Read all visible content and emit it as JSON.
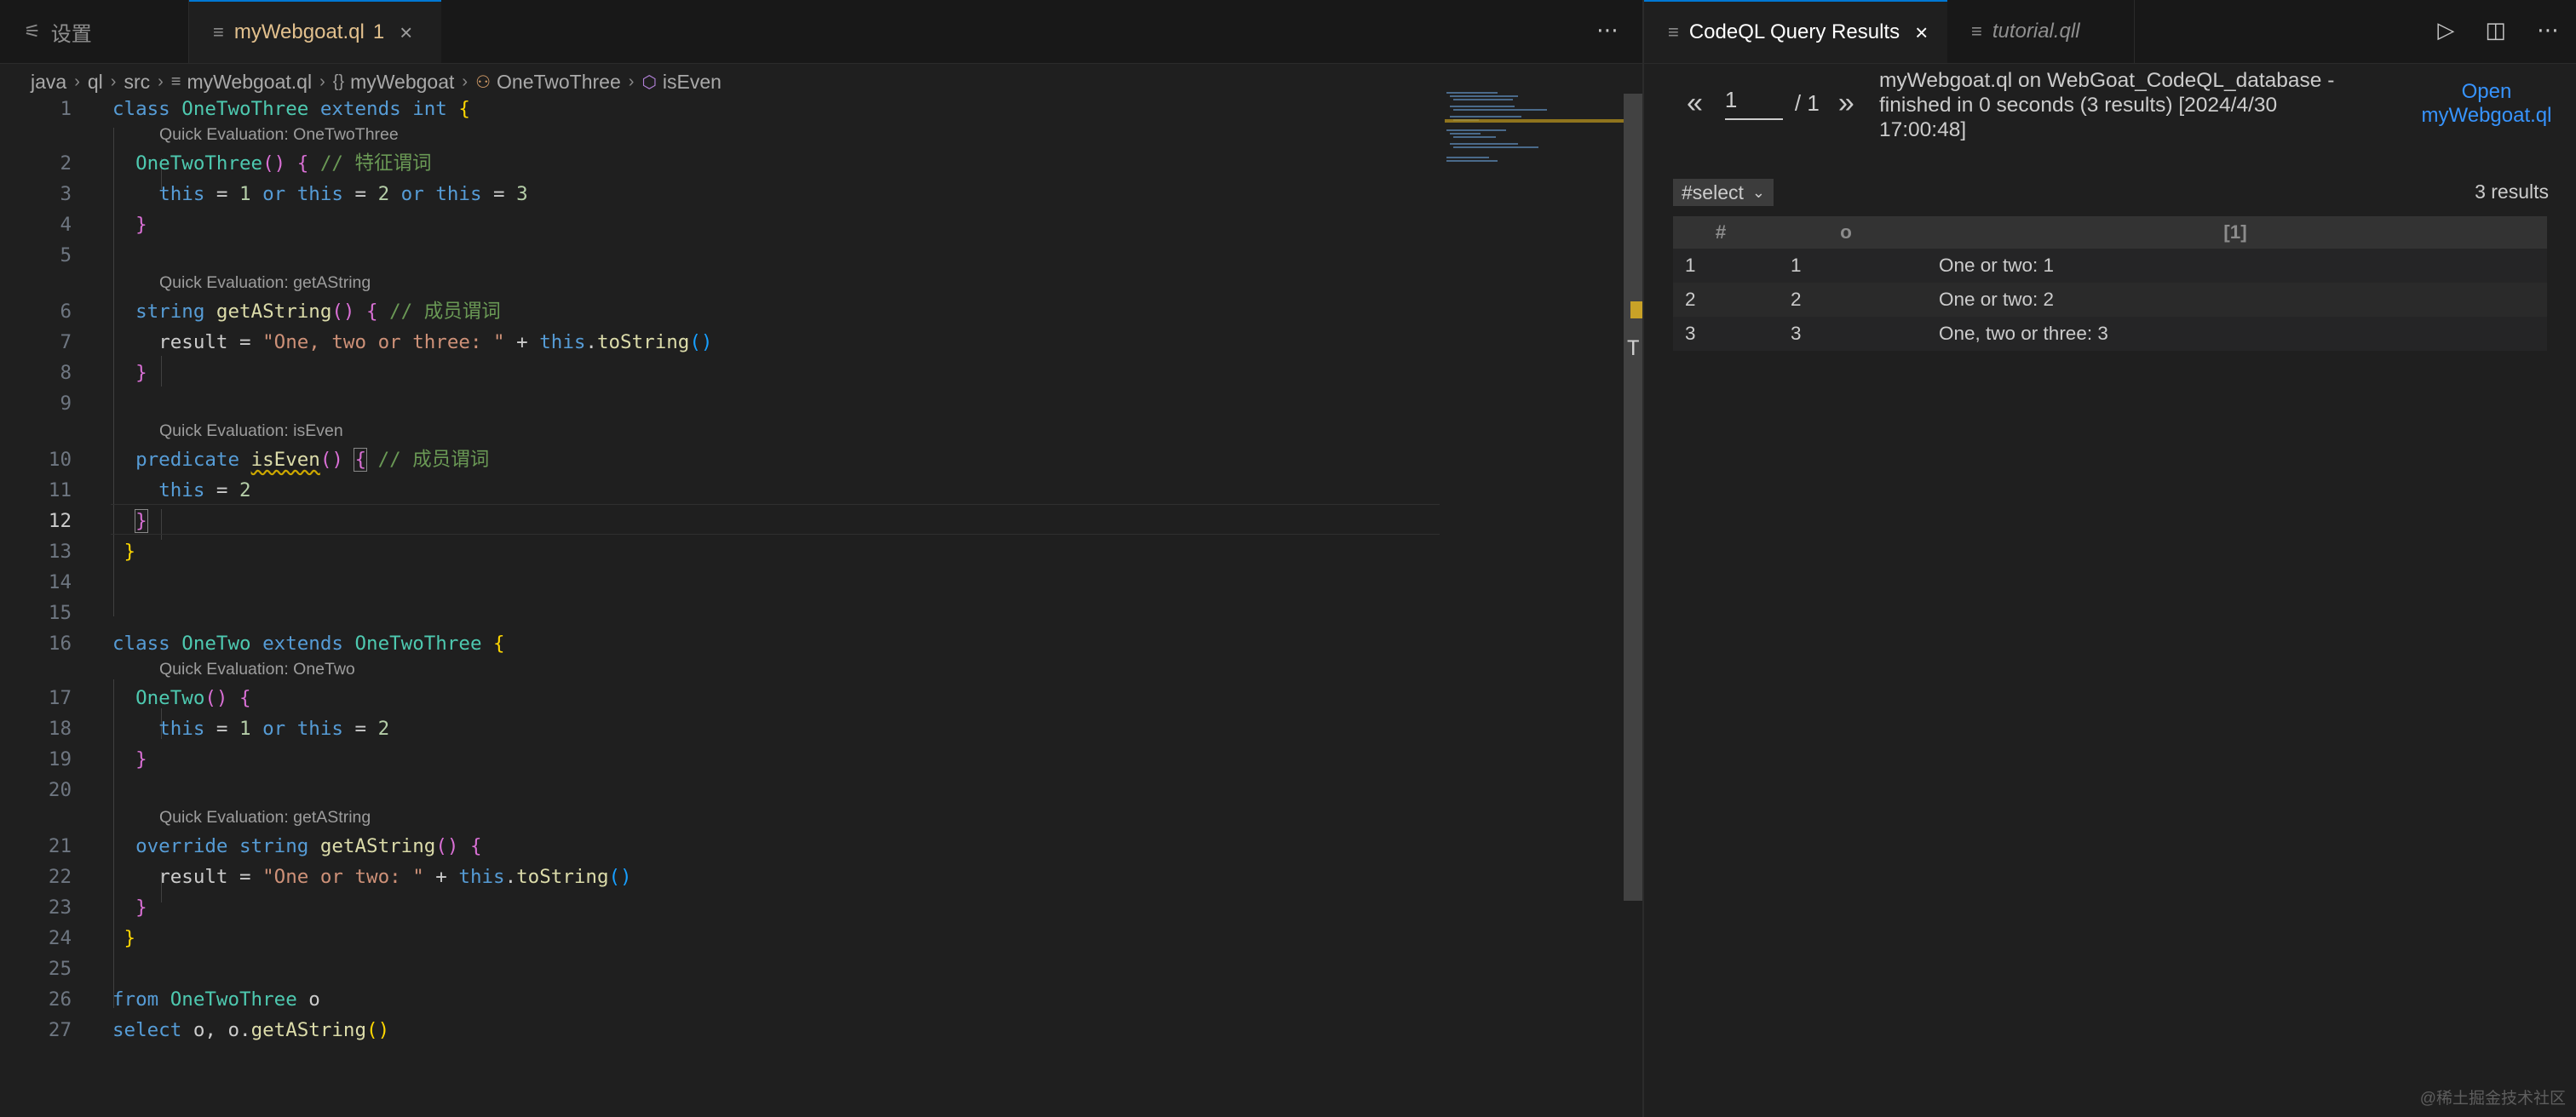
{
  "left_tabs": {
    "settings": {
      "label": "设置"
    },
    "file": {
      "label": "myWebgoat.ql",
      "badge": "1"
    }
  },
  "breadcrumb": [
    "java",
    "ql",
    "src",
    "myWebgoat.ql",
    "myWebgoat",
    "OneTwoThree",
    "isEven"
  ],
  "lens": {
    "l1": "Quick Evaluation: OneTwoThree",
    "l6": "Quick Evaluation: getAString",
    "l10": "Quick Evaluation: isEven",
    "l17": "Quick Evaluation: OneTwo",
    "l21": "Quick Evaluation: getAString"
  },
  "line_numbers": [
    "1",
    "2",
    "3",
    "4",
    "5",
    "6",
    "7",
    "8",
    "9",
    "10",
    "11",
    "12",
    "13",
    "14",
    "15",
    "16",
    "17",
    "18",
    "19",
    "20",
    "21",
    "22",
    "23",
    "24",
    "25",
    "26",
    "27"
  ],
  "code": {
    "kw_class": "class",
    "kw_extends": "extends",
    "kw_string": "string",
    "kw_this": "this",
    "kw_or": "or",
    "kw_predicate": "predicate",
    "kw_override": "override",
    "kw_from": "from",
    "kw_select": "select",
    "ty_int": "int",
    "ty_OneTwoThree": "OneTwoThree",
    "ty_OneTwo": "OneTwo",
    "fn_getAString": "getAString",
    "fn_isEven": "isEven",
    "fn_toString": "toString",
    "var_result": "result",
    "var_o": "o",
    "num_1": "1",
    "num_2": "2",
    "num_3": "3",
    "cm_char_pred": "// 特征谓词",
    "cm_member_pred": "// 成员谓词",
    "str_one_two_three": "\"One, two or three: \"",
    "str_one_or_two": "\"One or two: \""
  },
  "right_tabs": {
    "results": {
      "label": "CodeQL Query Results"
    },
    "tutorial": {
      "label": "tutorial.qll"
    }
  },
  "results": {
    "page": "1",
    "page_total": "/ 1",
    "info": "myWebgoat.ql on WebGoat_CodeQL_database - finished in 0 seconds (3 results) [2024/4/30 17:00:48]",
    "open_link": "Open myWebgoat.ql",
    "select_value": "#select",
    "count": "3 results",
    "headers": [
      "#",
      "o",
      "[1]"
    ],
    "rows": [
      [
        "1",
        "1",
        "One or two: 1"
      ],
      [
        "2",
        "2",
        "One or two: 2"
      ],
      [
        "3",
        "3",
        "One, two or three: 3"
      ]
    ]
  },
  "watermark": "@稀土掘金技术社区",
  "colors": {
    "accent": "#0078d4",
    "link": "#3794ff",
    "keyword": "#569cd6",
    "type": "#4ec9b0",
    "function": "#dcdcaa",
    "string": "#ce9178",
    "comment": "#6a9955"
  }
}
